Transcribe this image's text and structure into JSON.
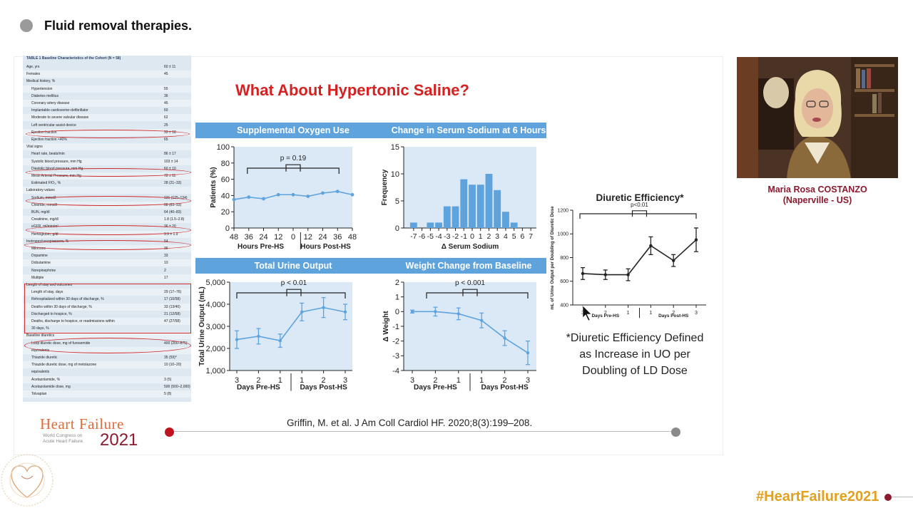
{
  "session": {
    "title": "Fluid removal therapies."
  },
  "slide": {
    "title": "What About Hypertonic Saline?",
    "citation": "Griffin, M. et al. J Am Coll Cardiol HF. 2020;8(3):199–208.",
    "note_lines": [
      "*Diuretic Efficiency Defined",
      "as Increase in UO per",
      "Doubling of LD Dose"
    ]
  },
  "table": {
    "title": "TABLE 1  Baseline Characteristics of the Cohort (N = 58)",
    "rows": [
      {
        "label": "Age, yrs",
        "value": "60 ± 11"
      },
      {
        "label": "Females",
        "value": "45"
      },
      {
        "label": "Medical history, %",
        "value": ""
      },
      {
        "label": "Hypertension",
        "value": "55",
        "indent": true
      },
      {
        "label": "Diabetes mellitus",
        "value": "36",
        "indent": true
      },
      {
        "label": "Coronary artery disease",
        "value": "45",
        "indent": true
      },
      {
        "label": "Implantable cardioverter-defibrillator",
        "value": "60",
        "indent": true
      },
      {
        "label": "Moderate to severe valvular disease",
        "value": "62",
        "indent": true
      },
      {
        "label": "Left ventricular assist device",
        "value": "25",
        "indent": true
      },
      {
        "label": "Ejection fraction",
        "value": "33 ± 18",
        "indent": true
      },
      {
        "label": "Ejection fraction <40%",
        "value": "65",
        "indent": true
      },
      {
        "label": "Vital signs",
        "value": ""
      },
      {
        "label": "Heart rate, beats/min",
        "value": "86 ± 17",
        "indent": true
      },
      {
        "label": "Systolic blood pressure, mm Hg",
        "value": "103 ± 14",
        "indent": true
      },
      {
        "label": "Diastolic blood pressure, mm Hg",
        "value": "60 ± 10",
        "indent": true
      },
      {
        "label": "Mean Arterial Pressure, mm Hg",
        "value": "72 ± 11",
        "indent": true
      },
      {
        "label": "Estimated FIO₂, %",
        "value": "28 (21–33)",
        "indent": true
      },
      {
        "label": "Laboratory values",
        "value": ""
      },
      {
        "label": "Sodium, mmol/l",
        "value": "131 (125–134)",
        "indent": true
      },
      {
        "label": "Chloride, mmol/l",
        "value": "88 (83–93)",
        "indent": true
      },
      {
        "label": "BUN, mg/dl",
        "value": "64 (40–83)",
        "indent": true
      },
      {
        "label": "Creatinine, mg/dl",
        "value": "1.8 (1.5–2.8)",
        "indent": true
      },
      {
        "label": "eGFR, ml/min/m²",
        "value": "36 ± 20",
        "indent": true
      },
      {
        "label": "Hemoglobin, g/dl",
        "value": "9.9 ± 1.9",
        "indent": true
      },
      {
        "label": "Inotropes/vasopressors, %",
        "value": "64"
      },
      {
        "label": "Milrinone",
        "value": "36",
        "indent": true
      },
      {
        "label": "Dopamine",
        "value": "33",
        "indent": true
      },
      {
        "label": "Dobutamine",
        "value": "10",
        "indent": true
      },
      {
        "label": "Norepinephrine",
        "value": "2",
        "indent": true
      },
      {
        "label": "Multiple",
        "value": "17",
        "indent": true
      },
      {
        "label": "Length of stay and outcomes",
        "value": ""
      },
      {
        "label": "Length of stay, days",
        "value": "29 (17–76)",
        "indent": true
      },
      {
        "label": "Rehospitalized within 30 days of discharge, %",
        "value": "17 (10/58)",
        "indent": true
      },
      {
        "label": "Deaths within 30 days of discharge, %",
        "value": "33 (13/40)",
        "indent": true
      },
      {
        "label": "Discharged to hospice, %",
        "value": "21 (12/58)",
        "indent": true
      },
      {
        "label": "Deaths, discharge to hospice, or readmissions within",
        "value": "47 (27/58)",
        "indent": true
      },
      {
        "label": "30 days, %",
        "value": "",
        "indent": true
      },
      {
        "label": "Baseline diuretics",
        "value": ""
      },
      {
        "label": "Loop diuretic dose, mg of furosemide",
        "value": "400 (200–875)",
        "indent": true
      },
      {
        "label": "equivalents",
        "value": "",
        "indent": true
      },
      {
        "label": "Thiazide diuretic",
        "value": "35 (59)*",
        "indent": true
      },
      {
        "label": "Thiazide diuretic dose, mg of metolazone",
        "value": "10 (10–20)",
        "indent": true
      },
      {
        "label": "equivalents",
        "value": "",
        "indent": true
      },
      {
        "label": "Acetazolamide, %",
        "value": "3 (5)",
        "indent": true
      },
      {
        "label": "Acetazolamide dose, mg",
        "value": "500 (500–2,000)",
        "indent": true
      },
      {
        "label": "Tolvaptan",
        "value": "5 (8)",
        "indent": true
      }
    ]
  },
  "panels": {
    "oxygen": {
      "header": "Supplemental Oxygen Use"
    },
    "sodium": {
      "header": "Change in Serum Sodium at 6 Hours"
    },
    "urine": {
      "header": "Total Urine Output"
    },
    "weight": {
      "header": "Weight Change from Baseline"
    }
  },
  "chart_data": [
    {
      "type": "line",
      "title": "Supplemental Oxygen Use",
      "ylabel": "Patients (%)",
      "x": [
        "48",
        "36",
        "24",
        "12",
        "0",
        "12",
        "24",
        "36",
        "48"
      ],
      "values": [
        35,
        38,
        36,
        41,
        41,
        39,
        43,
        45,
        41
      ],
      "ylim": [
        0,
        100
      ],
      "yticks": [
        "0",
        "20",
        "40",
        "60",
        "80",
        "100"
      ],
      "group_labels": [
        "Hours Pre-HS",
        "Hours Post-HS"
      ],
      "annotation": "p = 0.19",
      "color": "#5fa3dc"
    },
    {
      "type": "bar",
      "title": "Change in Serum Sodium at 6 Hours",
      "ylabel": "Frequency",
      "xlabel": "Δ Serum Sodium",
      "categories": [
        "-7",
        "-6",
        "-5",
        "-4",
        "-3",
        "-2",
        "-1",
        "0",
        "1",
        "2",
        "3",
        "4",
        "5",
        "6",
        "7"
      ],
      "values": [
        1,
        0,
        1,
        1,
        4,
        4,
        9,
        8,
        8,
        10,
        7,
        3,
        1,
        0,
        0
      ],
      "ylim": [
        0,
        15
      ],
      "yticks": [
        "0",
        "5",
        "10",
        "15"
      ],
      "color": "#5fa3dc"
    },
    {
      "type": "line",
      "title": "Total Urine Output",
      "ylabel": "Total Urine Output (mL)",
      "x": [
        "3",
        "2",
        "1",
        "1",
        "2",
        "3"
      ],
      "values": [
        2400,
        2550,
        2350,
        3650,
        3850,
        3650
      ],
      "errors": [
        400,
        350,
        300,
        400,
        450,
        350
      ],
      "ylim": [
        1000,
        5000
      ],
      "yticks": [
        "1,000",
        "2,000",
        "3,000",
        "4,000",
        "5,000"
      ],
      "group_labels": [
        "Days Pre-HS",
        "Days Post-HS"
      ],
      "annotation": "p < 0.01",
      "color": "#5fa3dc"
    },
    {
      "type": "line",
      "title": "Weight Change from Baseline",
      "ylabel": "Δ Weight",
      "x": [
        "3",
        "2",
        "1",
        "1",
        "2",
        "3"
      ],
      "values": [
        0,
        0,
        -0.15,
        -0.6,
        -1.8,
        -2.8
      ],
      "errors": [
        0.1,
        0.3,
        0.4,
        0.5,
        0.5,
        0.8
      ],
      "ylim": [
        -4,
        2
      ],
      "yticks": [
        "2",
        "1",
        "0",
        "-1",
        "-2",
        "-3",
        "-4"
      ],
      "group_labels": [
        "Days Pre-HS",
        "Days Post-HS"
      ],
      "annotation": "p < 0.001",
      "color": "#5fa3dc"
    },
    {
      "type": "line",
      "title": "Diuretic Efficiency*",
      "ylabel": "mL of Urine Output per Doubling of Diuretic Dose",
      "x": [
        "3",
        "2",
        "1",
        "1",
        "2",
        "3"
      ],
      "values": [
        665,
        655,
        655,
        900,
        775,
        950
      ],
      "errors": [
        50,
        40,
        50,
        75,
        50,
        100
      ],
      "ylim": [
        400,
        1200
      ],
      "yticks": [
        "400",
        "600",
        "800",
        "1000",
        "1200"
      ],
      "group_labels": [
        "Days Pre-HS",
        "Days Post-HS"
      ],
      "annotation": "p<0.01",
      "color": "#222222"
    }
  ],
  "speaker": {
    "name": "Maria Rosa COSTANZO",
    "location": "(Naperville - US)"
  },
  "branding": {
    "logo_line1": "Heart Failure",
    "logo_year": "2021",
    "logo_sub1": "World Congress on",
    "logo_sub2": "Acute Heart Failure",
    "hashtag": "#HeartFailure2021"
  },
  "colors": {
    "title_red": "#d42121",
    "panel_blue": "#5fa3dc",
    "accent_red": "#c1121f",
    "brand_maroon": "#8b1a2f",
    "hashtag_gold": "#e0a020"
  }
}
